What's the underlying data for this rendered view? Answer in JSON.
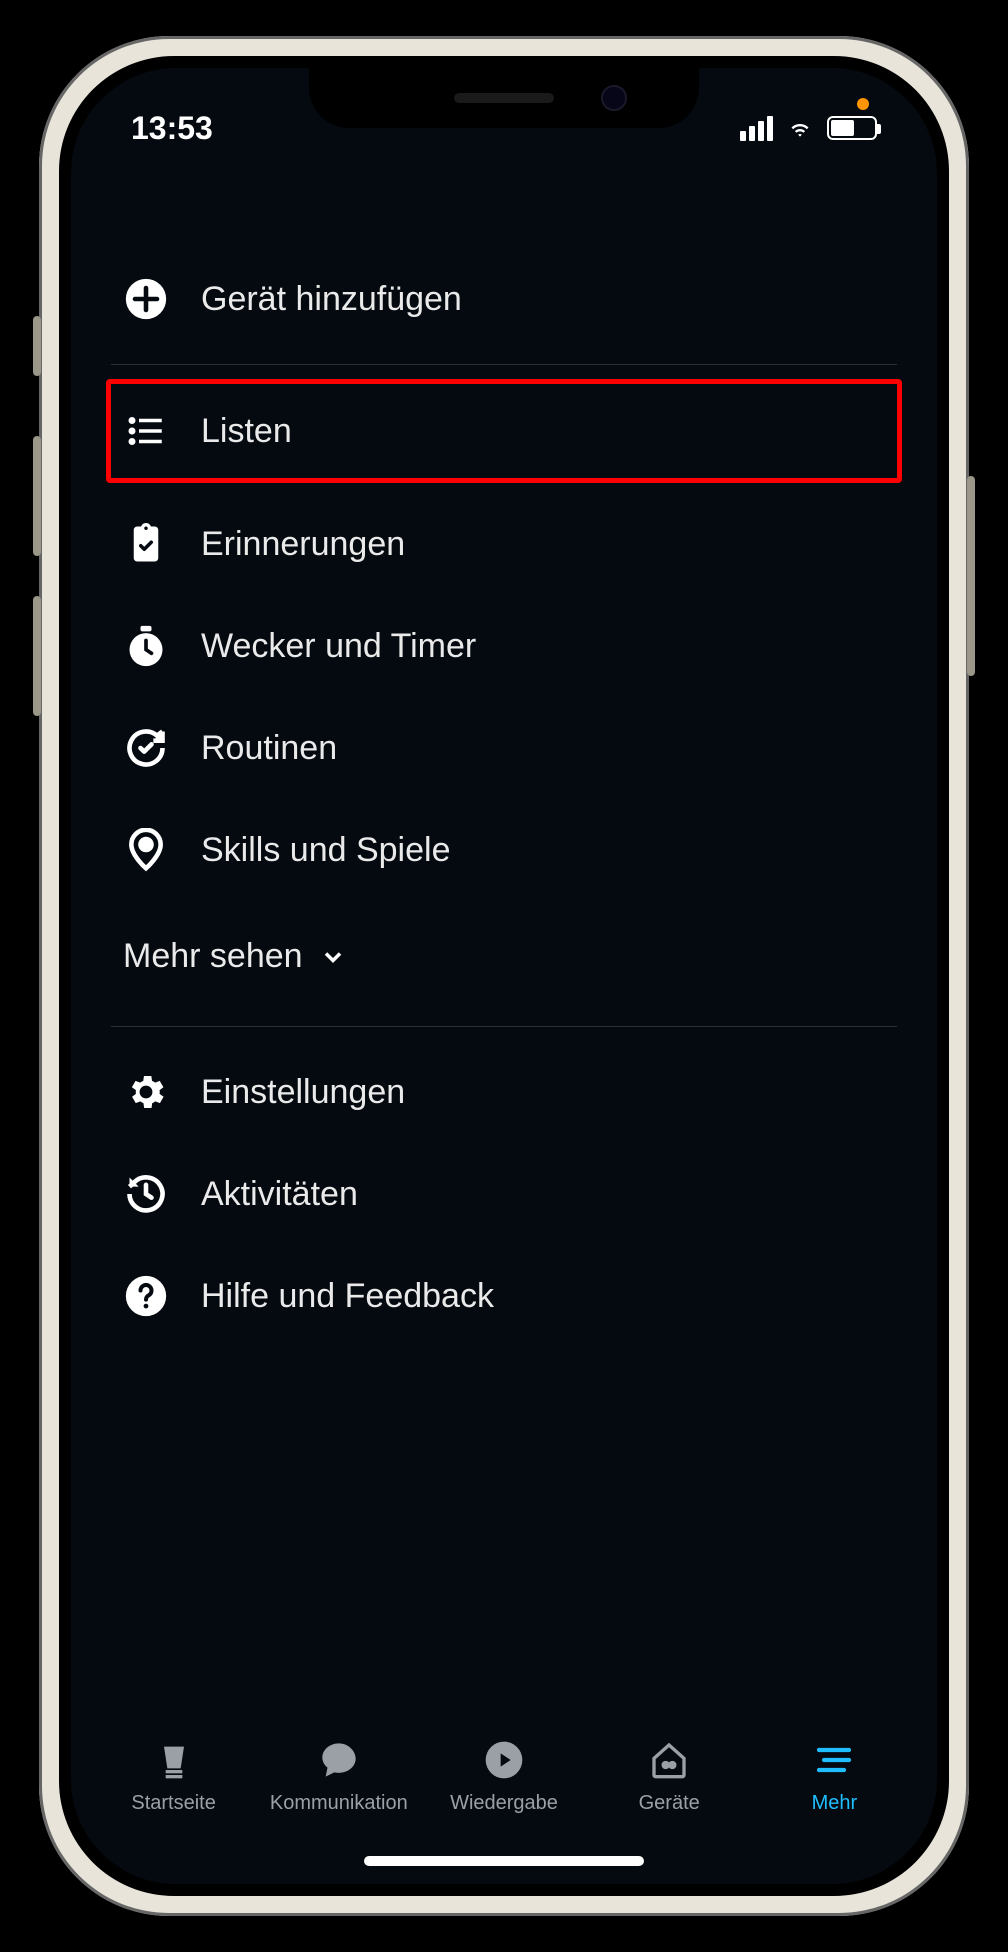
{
  "status": {
    "time": "13:53"
  },
  "menu": {
    "add_device": "Gerät hinzufügen",
    "lists": "Listen",
    "reminders": "Erinnerungen",
    "alarms_timers": "Wecker und Timer",
    "routines": "Routinen",
    "skills_games": "Skills und Spiele",
    "see_more": "Mehr sehen",
    "settings": "Einstellungen",
    "activities": "Aktivitäten",
    "help_feedback": "Hilfe und Feedback"
  },
  "nav": {
    "home": "Startseite",
    "communication": "Kommunikation",
    "playback": "Wiedergabe",
    "devices": "Geräte",
    "more": "Mehr"
  },
  "highlighted_item": "lists"
}
